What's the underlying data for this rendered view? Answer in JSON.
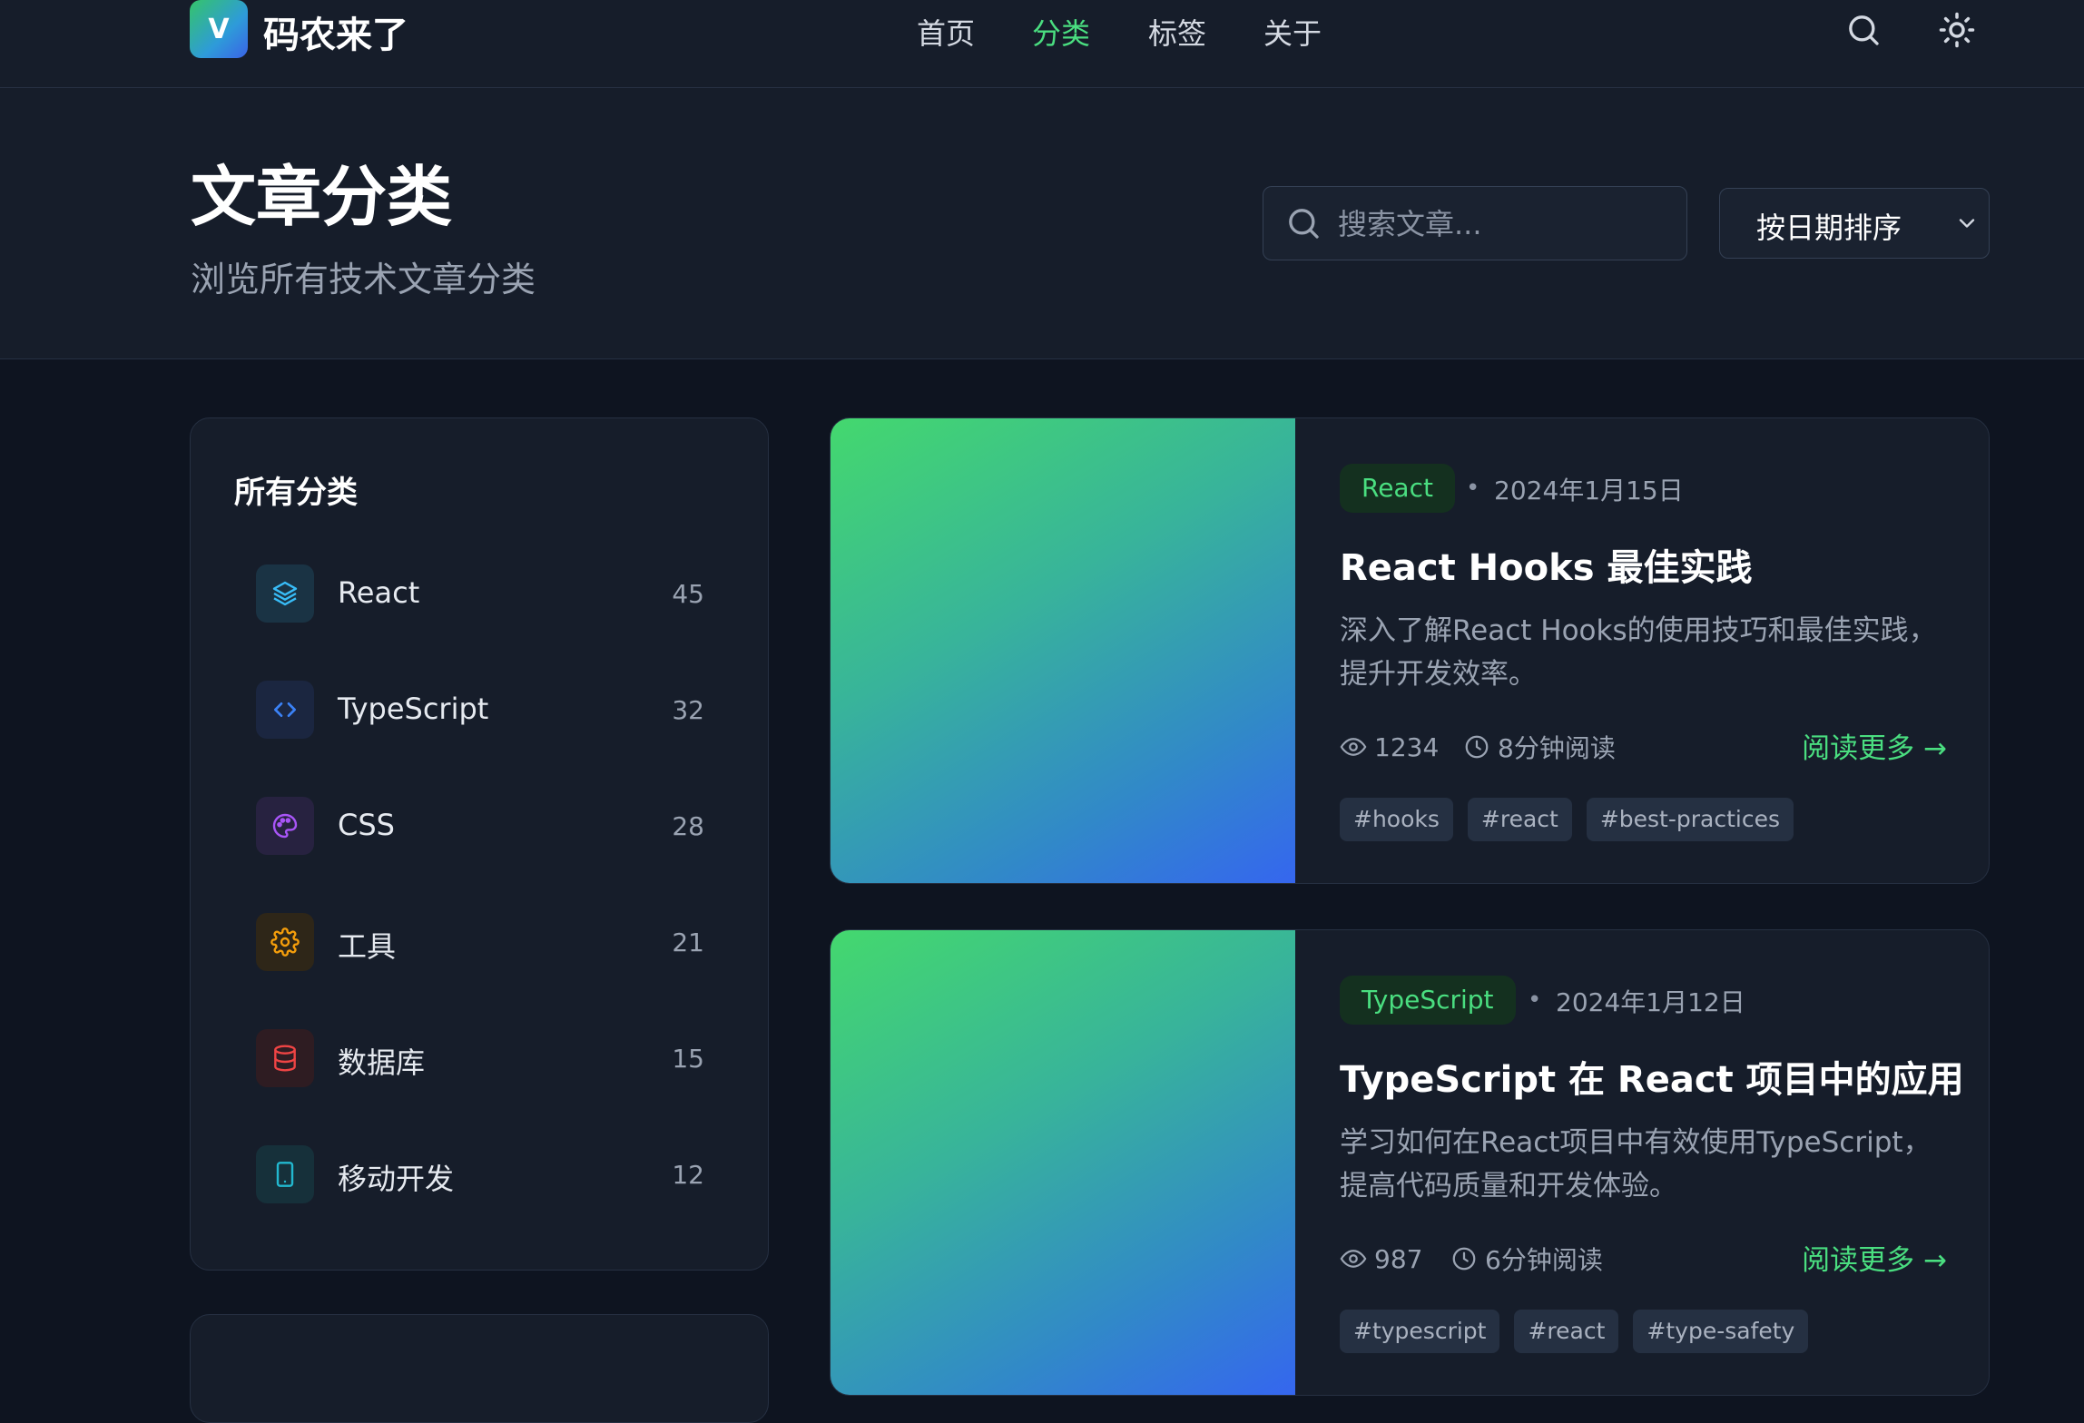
{
  "header": {
    "logo_letter": "V",
    "site_name": "码农来了",
    "nav": [
      {
        "label": "首页",
        "active": false
      },
      {
        "label": "分类",
        "active": true
      },
      {
        "label": "标签",
        "active": false
      },
      {
        "label": "关于",
        "active": false
      }
    ],
    "icons": [
      "search-icon",
      "sun-icon"
    ]
  },
  "hero": {
    "title": "文章分类",
    "subtitle": "浏览所有技术文章分类",
    "search_placeholder": "搜索文章...",
    "search_value": "",
    "sort_selected": "按日期排序"
  },
  "sidebar": {
    "title": "所有分类",
    "categories": [
      {
        "label": "React",
        "count": "45",
        "icon": "layers-icon",
        "color": "#38bdf8"
      },
      {
        "label": "TypeScript",
        "count": "32",
        "icon": "code-icon",
        "color": "#3b82f6"
      },
      {
        "label": "CSS",
        "count": "28",
        "icon": "palette-icon",
        "color": "#a855f7"
      },
      {
        "label": "工具",
        "count": "21",
        "icon": "gear-icon",
        "color": "#f59e0b"
      },
      {
        "label": "数据库",
        "count": "15",
        "icon": "database-icon",
        "color": "#ef4444"
      },
      {
        "label": "移动开发",
        "count": "12",
        "icon": "mobile-icon",
        "color": "#22b8cf"
      }
    ]
  },
  "articles": [
    {
      "category": "React",
      "date": "2024年1月15日",
      "title": "React Hooks 最佳实践",
      "excerpt": "深入了解React Hooks的使用技巧和最佳实践，提升开发效率。",
      "views": "1234",
      "read_time": "8分钟阅读",
      "read_more": "阅读更多 →",
      "tags": [
        "#hooks",
        "#react",
        "#best-practices"
      ]
    },
    {
      "category": "TypeScript",
      "date": "2024年1月12日",
      "title": "TypeScript 在 React 项目中的应用",
      "excerpt": "学习如何在React项目中有效使用TypeScript，提高代码质量和开发体验。",
      "views": "987",
      "read_time": "6分钟阅读",
      "read_more": "阅读更多 →",
      "tags": [
        "#typescript",
        "#react",
        "#type-safety"
      ]
    }
  ],
  "colors": {
    "accent": "#4ade80",
    "bg": "#0e1420",
    "panel": "#161d2a"
  }
}
